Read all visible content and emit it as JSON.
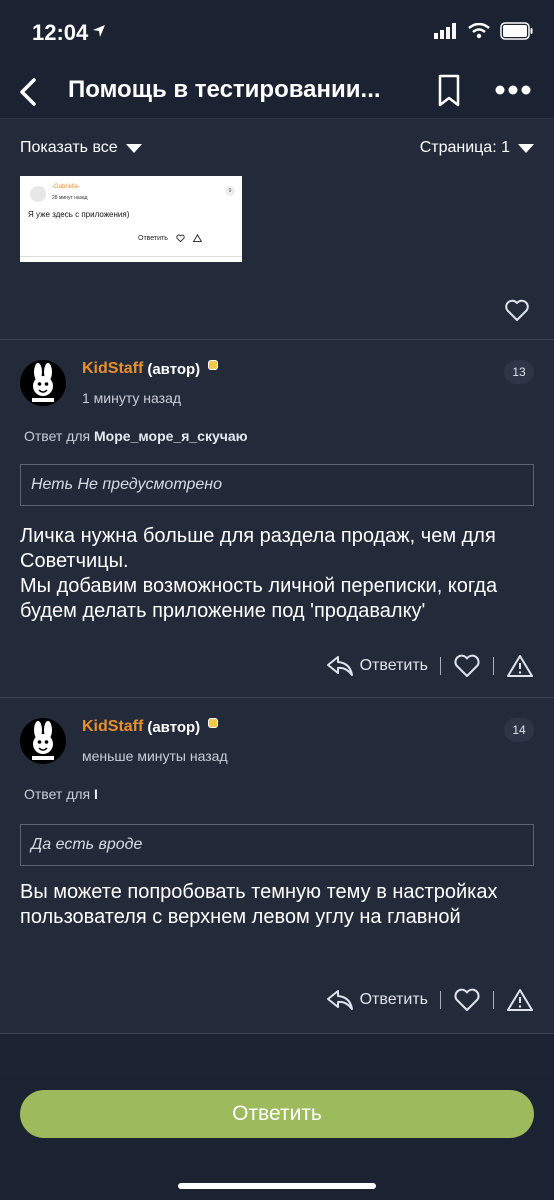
{
  "status": {
    "time": "12:04"
  },
  "nav": {
    "title": "Помощь в тестировании..."
  },
  "filter": {
    "show_all": "Показать все",
    "page": "Страница: 1"
  },
  "prev_thumb": {
    "name": "-Gabriella-",
    "time": "28 минут назад",
    "badge": "9",
    "text": "Я уже здесь с приложения)",
    "reply": "Ответить"
  },
  "posts": [
    {
      "author": "KidStaff",
      "role": "(автор)",
      "time": "1 минуту назад",
      "number": "13",
      "reply_prefix": "Ответ для",
      "reply_user": "Море_море_я_скучаю",
      "quote": "Неть Не предусмотрено",
      "body": "Личка нужна больше для раздела продаж, чем для Советчицы.\nМы добавим возможность личной переписки, когда будем делать приложение под 'продавалку'",
      "reply_label": "Ответить"
    },
    {
      "author": "KidStaff",
      "role": "(автор)",
      "time": "меньше минуты назад",
      "number": "14",
      "reply_prefix": "Ответ для",
      "reply_user": "I",
      "quote": "Да есть вроде",
      "body": "Вы можете попробовать темную тему в настройках пользователя с верхнем левом углу на главной",
      "reply_label": "Ответить"
    }
  ],
  "bottom": {
    "reply_button": "Ответить"
  },
  "colors": {
    "background": "#1c2333",
    "author": "#e8902c",
    "reply_button": "#9dba5c"
  }
}
